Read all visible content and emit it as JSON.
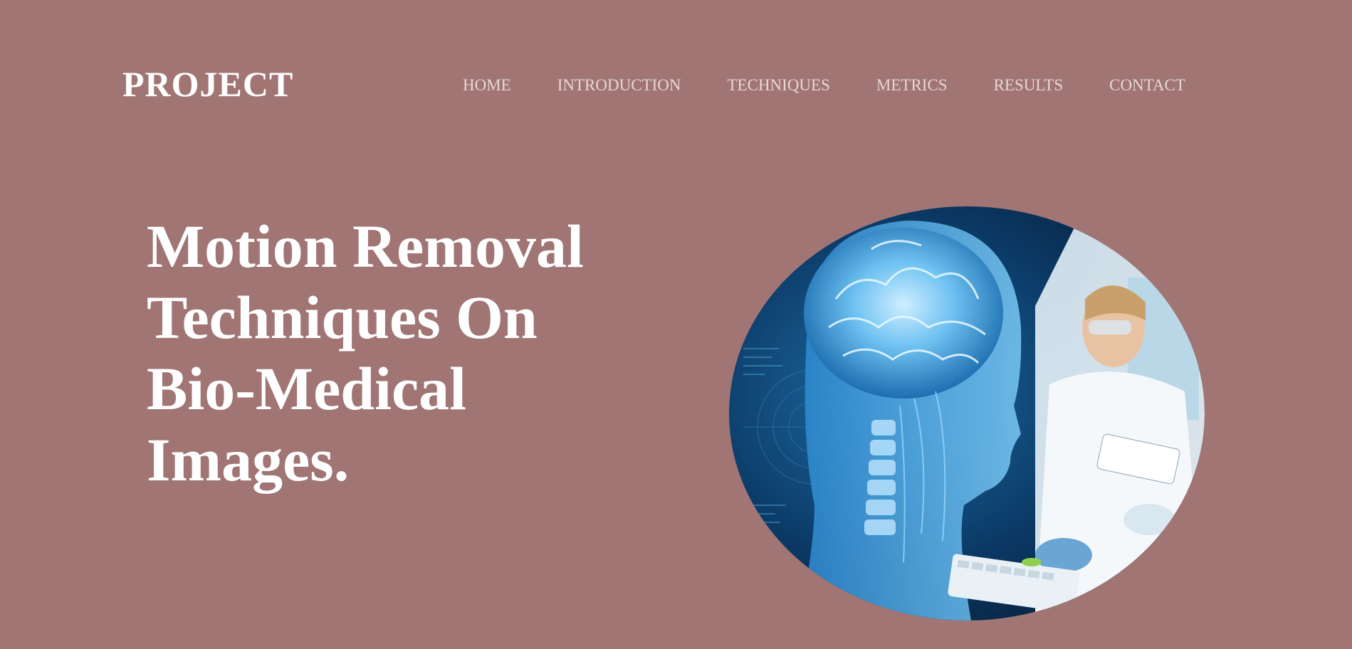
{
  "header": {
    "logo": "PROJECT",
    "nav": [
      {
        "label": "HOME"
      },
      {
        "label": "INTRODUCTION"
      },
      {
        "label": "TECHNIQUES"
      },
      {
        "label": "METRICS"
      },
      {
        "label": "RESULTS"
      },
      {
        "label": "CONTACT"
      }
    ]
  },
  "hero": {
    "title": "Motion Removal Techniques On Bio-Medical Images.",
    "image": {
      "description_icon": "brain-scan-lab-image"
    }
  },
  "colors": {
    "background": "#a07574",
    "text": "#ffffff",
    "nav_text": "#e8d6d6",
    "image_primary": "#0d3b66",
    "image_accent": "#5fb8ef"
  }
}
